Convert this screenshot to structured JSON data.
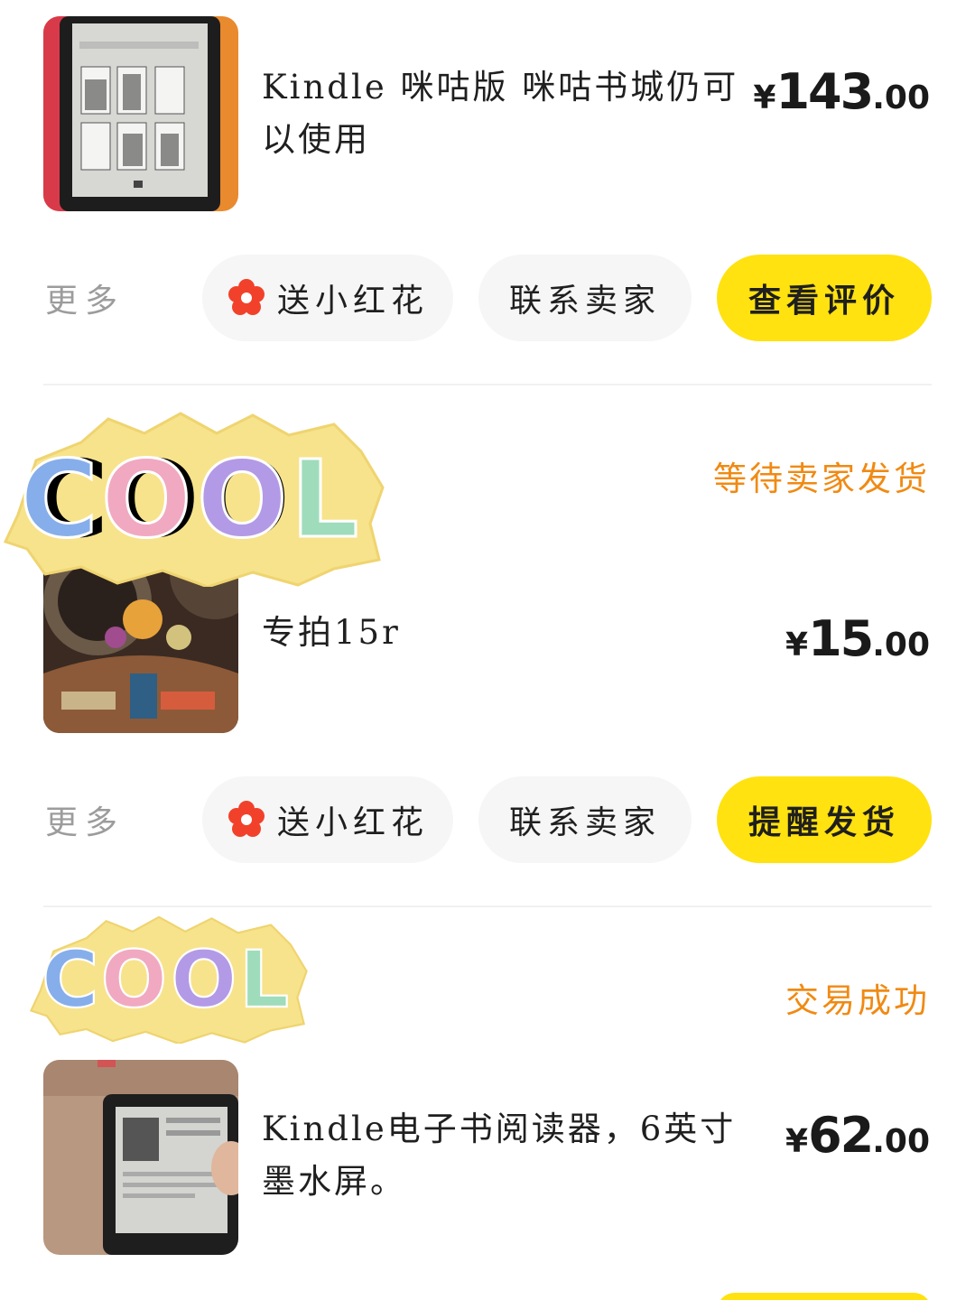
{
  "colors": {
    "accent_yellow": "#ffe20f",
    "status_orange": "#f08a13",
    "muted_gray": "#9c9c9c",
    "pill_bg": "#f6f6f6",
    "flower_red": "#f2412a"
  },
  "sticker_text": "COOL",
  "orders": [
    {
      "title": "Kindle 咪咕版 咪咕书城仍可以使用",
      "price": {
        "currency": "¥",
        "integer": "143",
        "decimal": ".00"
      },
      "actions": {
        "more": "更多",
        "flower": "送小红花",
        "contact": "联系卖家",
        "primary": "查看评价"
      }
    },
    {
      "status": "等待卖家发货",
      "title": "专拍15r",
      "price": {
        "currency": "¥",
        "integer": "15",
        "decimal": ".00"
      },
      "actions": {
        "more": "更多",
        "flower": "送小红花",
        "contact": "联系卖家",
        "primary": "提醒发货"
      }
    },
    {
      "status": "交易成功",
      "title": "Kindle电子书阅读器，6英寸墨水屏。",
      "price": {
        "currency": "¥",
        "integer": "62",
        "decimal": ".00"
      }
    }
  ]
}
